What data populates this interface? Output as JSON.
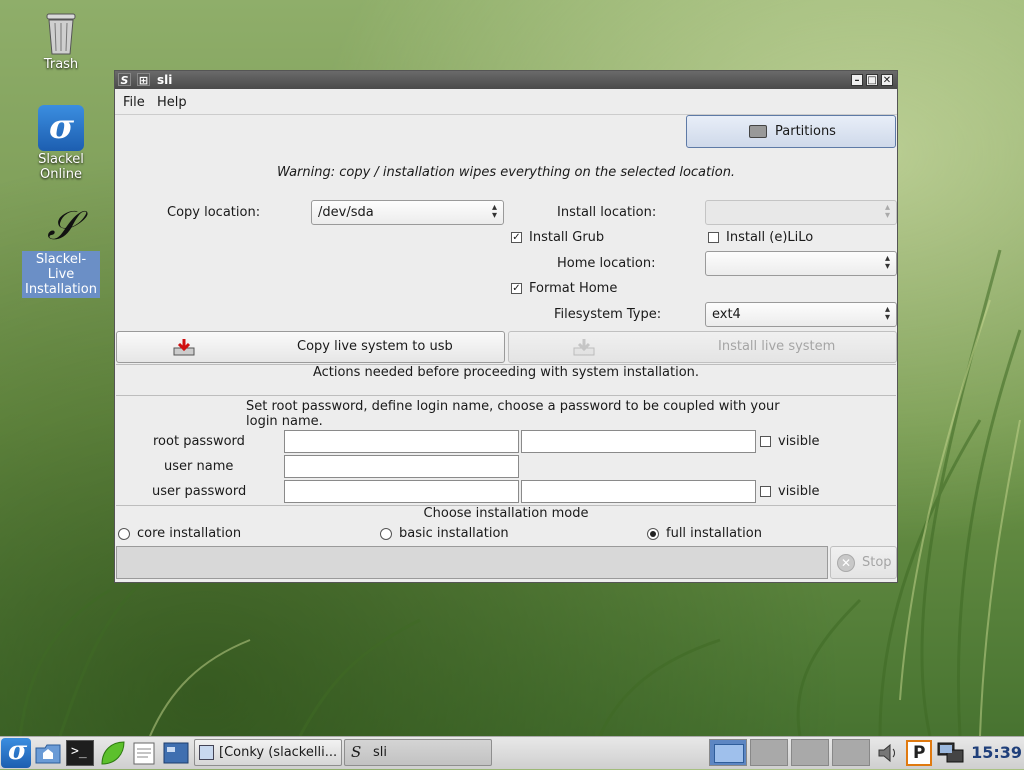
{
  "desktop": {
    "icons": [
      {
        "label": "Trash"
      },
      {
        "label": "Slackel Online"
      },
      {
        "label": "Slackel-Live\nInstallation"
      }
    ]
  },
  "window": {
    "title": "sli",
    "menu": {
      "file": "File",
      "help": "Help"
    },
    "partitions_label": "Partitions",
    "warning": "Warning: copy / installation wipes everything on the selected location.",
    "copy_location_label": "Copy location:",
    "copy_location_value": "/dev/sda",
    "install_location_label": "Install location:",
    "install_location_value": "",
    "install_grub_label": "Install Grub",
    "install_grub_checked": true,
    "install_elilo_label": "Install (e)LiLo",
    "install_elilo_checked": false,
    "home_location_label": "Home location:",
    "home_location_value": "",
    "format_home_label": "Format Home",
    "format_home_checked": true,
    "filesystem_type_label": "Filesystem Type:",
    "filesystem_type_value": "ext4",
    "copy_button_label": "Copy live system to usb",
    "install_button_label": "Install live system",
    "actions_text": "Actions needed before proceeding with system installation.",
    "password_instructions_1": "Set root password, define login name, choose a password to be coupled with your",
    "password_instructions_2": "login name.",
    "root_password_label": "root password",
    "user_name_label": "user name",
    "user_password_label": "user password",
    "visible_label": "visible",
    "mode_title": "Choose installation mode",
    "modes": [
      {
        "label": "core installation",
        "selected": false
      },
      {
        "label": "basic installation",
        "selected": false
      },
      {
        "label": "full installation",
        "selected": true
      }
    ],
    "stop_label": "Stop"
  },
  "taskbar": {
    "tasks": [
      {
        "label": "[Conky (slackelli..."
      },
      {
        "label": "sli"
      }
    ],
    "clock": "15:39"
  },
  "colors": {
    "selection": "#6b8fc6",
    "titlebar": "#4a4a4a",
    "clock": "#1f3f7a"
  }
}
